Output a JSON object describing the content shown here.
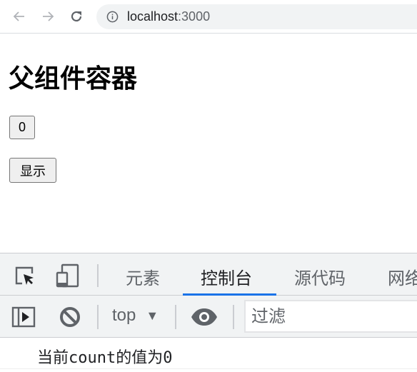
{
  "browser": {
    "url_host": "localhost",
    "url_port": ":3000",
    "back_label": "back",
    "forward_label": "forward",
    "reload_label": "reload"
  },
  "page": {
    "heading": "父组件容器",
    "count_button_label": "0",
    "show_button_label": "显示"
  },
  "devtools": {
    "tabs": [
      {
        "label": "元素",
        "active": false
      },
      {
        "label": "控制台",
        "active": true
      },
      {
        "label": "源代码",
        "active": false
      },
      {
        "label": "网络",
        "active": false
      }
    ],
    "toolbar": {
      "context": "top",
      "filter_placeholder": "过滤"
    },
    "console": {
      "messages": [
        "当前count的值为0"
      ]
    },
    "accent_color": "#1a73e8"
  }
}
